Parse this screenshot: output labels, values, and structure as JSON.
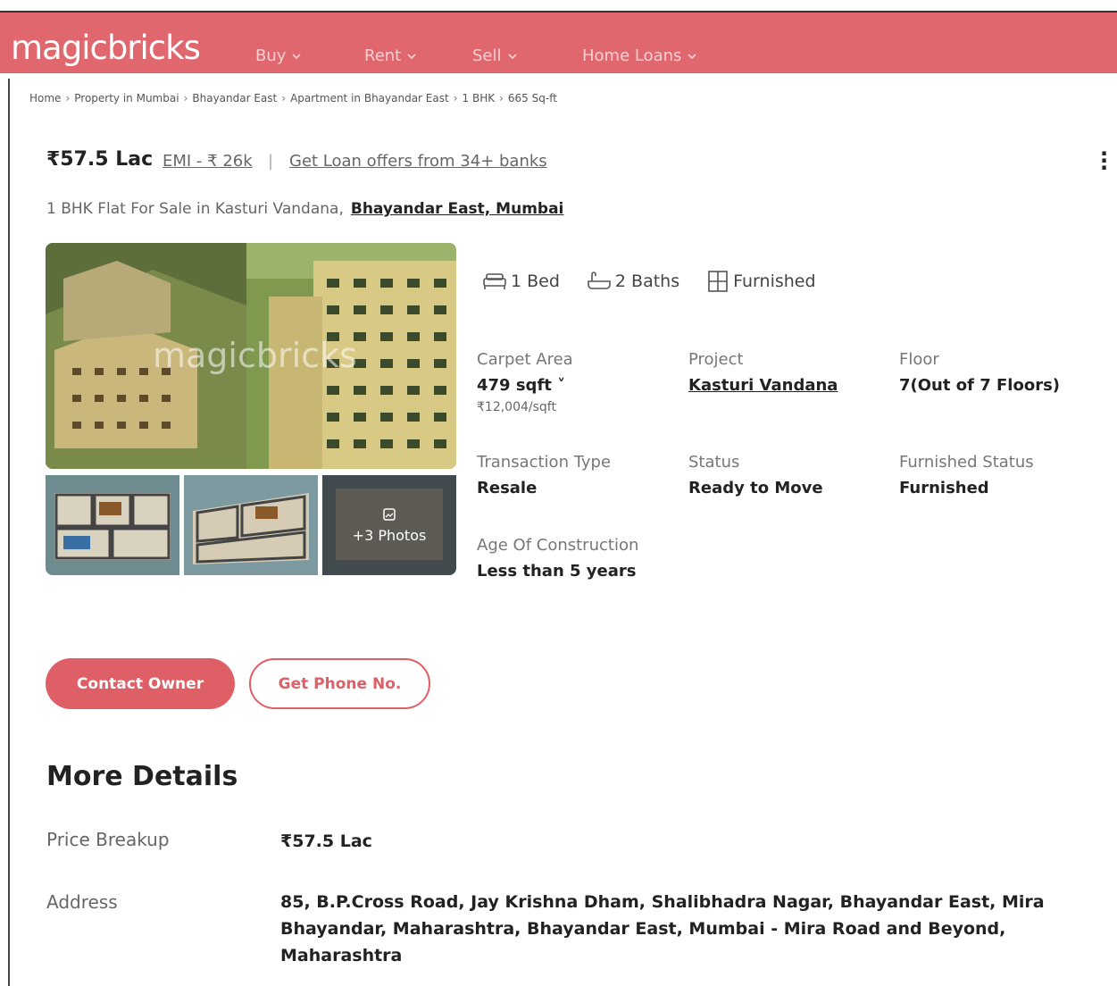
{
  "header": {
    "logo": "magicbricks",
    "nav": [
      {
        "label": "Buy"
      },
      {
        "label": "Rent"
      },
      {
        "label": "Sell"
      },
      {
        "label": "Home Loans"
      }
    ]
  },
  "breadcrumb": [
    "Home",
    "Property in Mumbai",
    "Bhayandar East",
    "Apartment in Bhayandar East",
    "1 BHK",
    "665 Sq-ft"
  ],
  "listing": {
    "price": "₹57.5 Lac",
    "emi": "EMI - ₹ 26k",
    "pipe": "|",
    "loan_offer": "Get Loan offers from 34+ banks",
    "title": "1 BHK Flat For Sale in Kasturi Vandana,",
    "location": "Bhayandar East, Mumbai"
  },
  "gallery": {
    "watermark": "magicbricks",
    "more_photos": "+3 Photos"
  },
  "features": {
    "bed": "1 Bed",
    "baths": "2 Baths",
    "furnished": "Furnished"
  },
  "details": {
    "carpet_area_label": "Carpet Area",
    "carpet_area_value": "479 sqft ˅",
    "carpet_area_rate": "₹12,004/sqft",
    "project_label": "Project",
    "project_value": "Kasturi Vandana",
    "floor_label": "Floor",
    "floor_value": "7(Out of 7 Floors)",
    "transaction_label": "Transaction Type",
    "transaction_value": "Resale",
    "status_label": "Status",
    "status_value": "Ready to Move",
    "furnished_label": "Furnished Status",
    "furnished_value": "Furnished",
    "age_label": "Age Of Construction",
    "age_value": "Less than 5 years"
  },
  "actions": {
    "contact_owner": "Contact Owner",
    "get_phone": "Get Phone No."
  },
  "more_details": {
    "title": "More Details",
    "price_breakup_label": "Price Breakup",
    "price_breakup_value": "₹57.5 Lac",
    "address_label": "Address",
    "address_value": "85, B.P.Cross Road, Jay Krishna Dham, Shalibhadra Nagar, Bhayandar East, Mira Bhayandar, Maharashtra, Bhayandar East, Mumbai - Mira Road and Beyond, Maharashtra"
  },
  "colors": {
    "brand": "#e0676e",
    "button": "#df5f66"
  }
}
